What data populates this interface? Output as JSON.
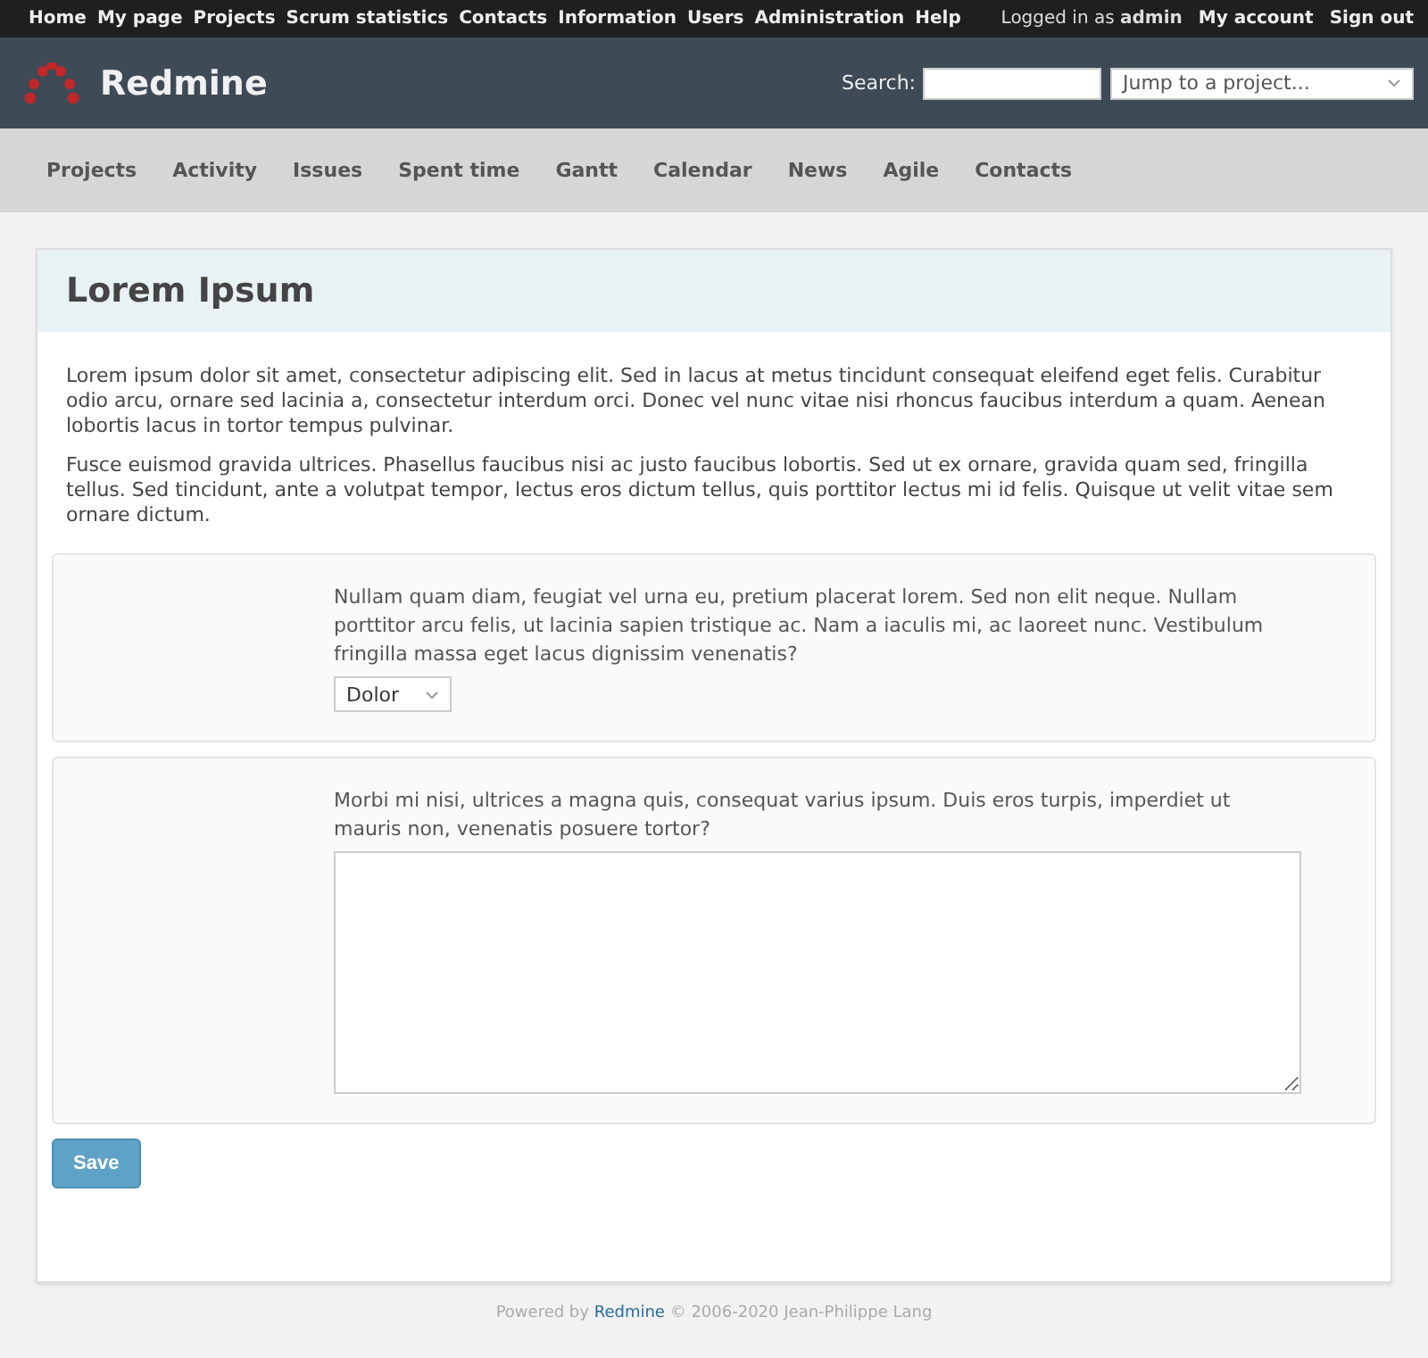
{
  "top_menu": {
    "links": [
      "Home",
      "My page",
      "Projects",
      "Scrum statistics",
      "Contacts",
      "Information",
      "Users",
      "Administration",
      "Help"
    ],
    "logged_in": "Logged in as **admin**",
    "account_links": [
      "My account",
      "Sign out"
    ]
  },
  "header": {
    "title": "Redmine",
    "search_label": "Search:",
    "project_jump": "Jump to a project..."
  },
  "main_menu": [
    "Projects",
    "Activity",
    "Issues",
    "Spent time",
    "Gantt",
    "Calendar",
    "News",
    "Agile",
    "Contacts"
  ],
  "page": {
    "title": "Lorem Ipsum",
    "paragraphs": [
      "Lorem ipsum dolor sit amet, consectetur adipiscing elit. Sed in lacus at metus tincidunt consequat eleifend eget felis. Curabitur odio arcu, ornare sed lacinia a, consectetur interdum orci. Donec vel nunc vitae nisi rhoncus faucibus interdum a quam. Aenean lobortis lacus in tortor tempus pulvinar.",
      "Fusce euismod gravida ultrices. Phasellus faucibus nisi ac justo faucibus lobortis. Sed ut ex ornare, gravida quam sed, fringilla tellus. Sed tincidunt, ante a volutpat tempor, lectus eros dictum tellus, quis porttitor lectus mi id felis. Quisque ut velit vitae sem ornare dictum."
    ],
    "questions": [
      {
        "kind": "select",
        "text": "Nullam quam diam, feugiat vel urna eu, pretium placerat lorem. Sed non elit neque. Nullam porttitor arcu felis, ut lacinia sapien tristique ac. Nam a iaculis mi, ac laoreet nunc. Vestibulum fringilla massa eget lacus dignissim venenatis?",
        "value": "Dolor"
      },
      {
        "kind": "textarea",
        "text": "Morbi mi nisi, ultrices a magna quis, consequat varius ipsum. Duis eros turpis, imperdiet ut mauris non, venenatis posuere tortor?"
      }
    ],
    "save_button": "Save"
  },
  "footer": {
    "before": "Powered by",
    "link": "Redmine",
    "after": "© 2006-2020 Jean-Philippe Lang"
  }
}
